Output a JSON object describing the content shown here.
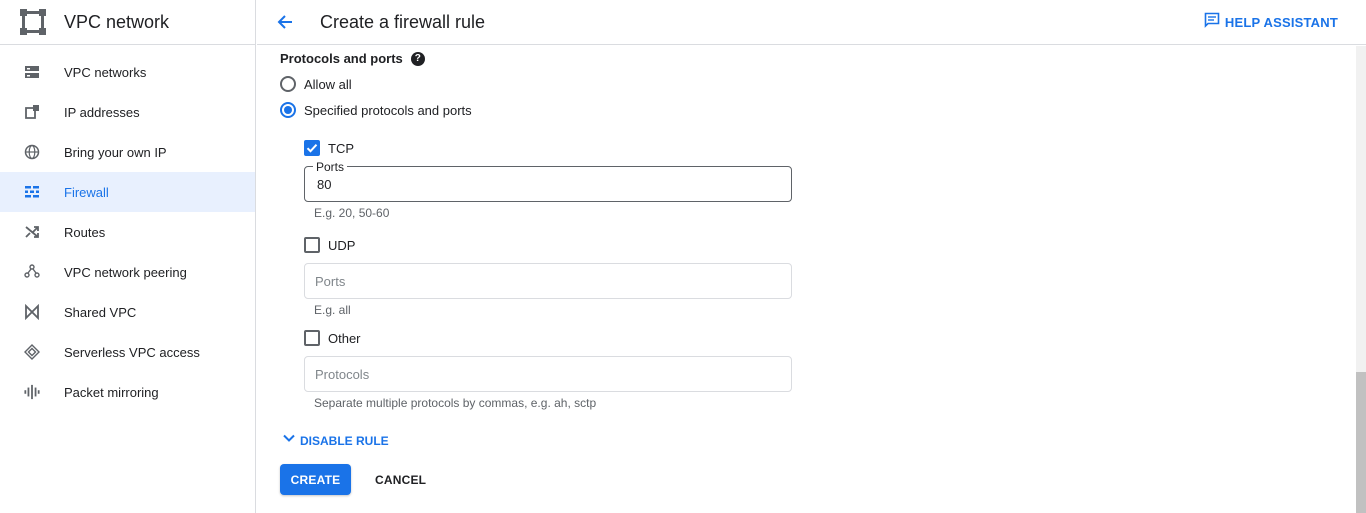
{
  "sidebar": {
    "title": "VPC network",
    "items": [
      {
        "label": "VPC networks",
        "icon": "vpc-networks-icon"
      },
      {
        "label": "IP addresses",
        "icon": "ip-addresses-icon"
      },
      {
        "label": "Bring your own IP",
        "icon": "globe-icon"
      },
      {
        "label": "Firewall",
        "icon": "firewall-icon",
        "active": true
      },
      {
        "label": "Routes",
        "icon": "routes-icon"
      },
      {
        "label": "VPC network peering",
        "icon": "peering-icon"
      },
      {
        "label": "Shared VPC",
        "icon": "shared-vpc-icon"
      },
      {
        "label": "Serverless VPC access",
        "icon": "serverless-icon"
      },
      {
        "label": "Packet mirroring",
        "icon": "packet-mirroring-icon"
      }
    ]
  },
  "header": {
    "title": "Create a firewall rule",
    "help_label": "HELP ASSISTANT"
  },
  "form": {
    "section_title": "Protocols and ports",
    "help_glyph": "?",
    "radio_allow_all": "Allow all",
    "radio_specified": "Specified protocols and ports",
    "selected_radio": "specified",
    "tcp": {
      "label": "TCP",
      "checked": true,
      "ports_label": "Ports",
      "ports_value": "80",
      "hint": "E.g. 20, 50-60"
    },
    "udp": {
      "label": "UDP",
      "checked": false,
      "placeholder": "Ports",
      "hint": "E.g. all"
    },
    "other": {
      "label": "Other",
      "checked": false,
      "placeholder": "Protocols",
      "hint": "Separate multiple protocols by commas, e.g. ah, sctp"
    },
    "disable_rule": "DISABLE RULE",
    "create_label": "CREATE",
    "cancel_label": "CANCEL"
  },
  "colors": {
    "accent": "#1a73e8",
    "active_bg": "#e8f0fe",
    "text": "#202124",
    "muted": "#5f6368"
  }
}
